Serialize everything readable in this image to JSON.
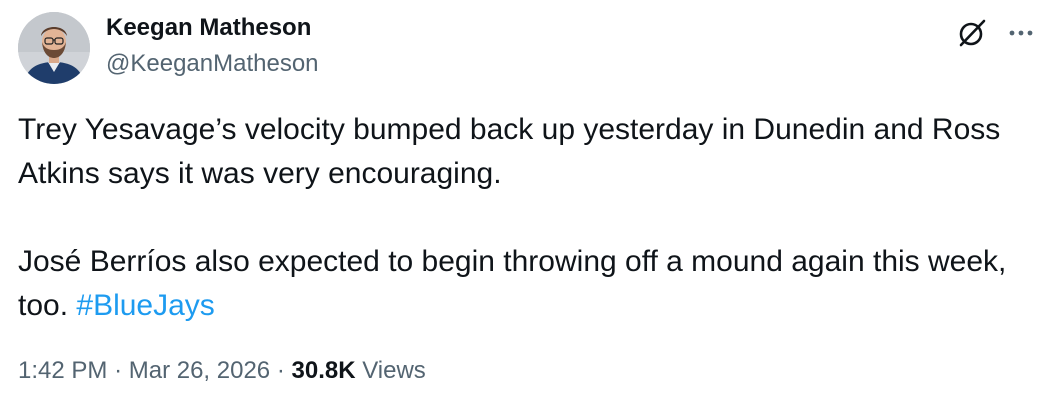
{
  "author": {
    "name": "Keegan Matheson",
    "handle": "@KeeganMatheson"
  },
  "tweet": {
    "line1": "Trey Yesavage’s velocity bumped back up yesterday in Dunedin and Ross Atkins says it was very encouraging.",
    "line2_text": "José Berríos also expected to begin throwing off a mound again this week, too.",
    "hashtag": "#BlueJays"
  },
  "meta": {
    "time": "1:42 PM",
    "separator": "·",
    "date": "Mar 26, 2026",
    "views_count": "30.8K",
    "views_label": "Views"
  },
  "icons": {
    "grok": "grok-icon",
    "more": "more-dots-icon",
    "avatar": "avatar"
  },
  "colors": {
    "text": "#0f1419",
    "secondary": "#536471",
    "link": "#1d9bf0"
  }
}
